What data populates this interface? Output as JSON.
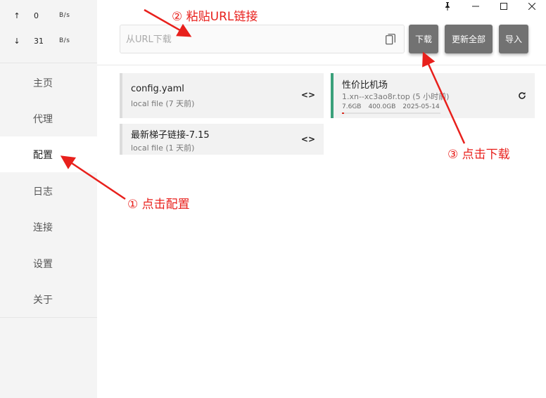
{
  "window": {
    "pin_icon": "pin-icon",
    "minimize_icon": "minimize-icon",
    "maximize_icon": "maximize-icon",
    "close_icon": "close-icon"
  },
  "traffic": {
    "upload_arrow": "↑",
    "upload_value": "0",
    "upload_unit": "B/s",
    "download_arrow": "↓",
    "download_value": "31",
    "download_unit": "B/s"
  },
  "sidebar": {
    "items": [
      {
        "label": "主页"
      },
      {
        "label": "代理"
      },
      {
        "label": "配置",
        "active": true
      },
      {
        "label": "日志"
      },
      {
        "label": "连接"
      },
      {
        "label": "设置"
      },
      {
        "label": "关于"
      }
    ]
  },
  "toolbar": {
    "url_placeholder": "从URL下载",
    "url_value": "",
    "download_label": "下载",
    "update_all_label": "更新全部",
    "import_label": "导入"
  },
  "profiles": [
    {
      "name": "config.yaml",
      "sub": "local file (7 天前)",
      "icon": "code-icon"
    },
    {
      "name": "最新梯子链接-7.15",
      "sub": "local file (1 天前)",
      "icon": "code-icon"
    },
    {
      "name": "性价比机场",
      "sub": "1.xn--xc3ao8r.top (5 小时前)",
      "used": "7.6GB",
      "total": "400.0GB",
      "expire": "2025-05-14",
      "usage_fraction": 0.019,
      "icon": "refresh-icon",
      "selected": true
    }
  ],
  "annotations": {
    "step1": "① 点击配置",
    "step2": "② 粘贴URL链接",
    "step3": "③ 点击下载",
    "color": "#e8201c"
  },
  "colors": {
    "sidebar_bg": "#f4f4f4",
    "button_bg": "#727272",
    "selected_accent": "#3aa07a"
  }
}
